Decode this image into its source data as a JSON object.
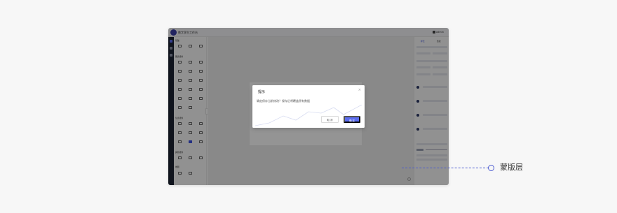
{
  "window": {
    "app_title": "数字孪生工作台",
    "user_label": "admin"
  },
  "left_panel": {
    "sections": [
      {
        "title": "基础"
      },
      {
        "title": "图表组件"
      },
      {
        "title": "信息组件"
      },
      {
        "title": "其他组件"
      },
      {
        "title": "地图"
      }
    ]
  },
  "right_panel": {
    "tabs": [
      "样式",
      "数据"
    ]
  },
  "dialog": {
    "title": "提示",
    "message": "确定保存当前修改？保存后将覆盖原有数据",
    "cancel_label": "取 消",
    "ok_label": "确 定",
    "close_icon": "close-icon"
  },
  "annotation": {
    "label": "蒙版层",
    "color": "#4a5ad0"
  },
  "colors": {
    "mask": "rgba(0,0,0,0.42)",
    "accent": "#5b6cf0",
    "rail": "#1c2333"
  }
}
